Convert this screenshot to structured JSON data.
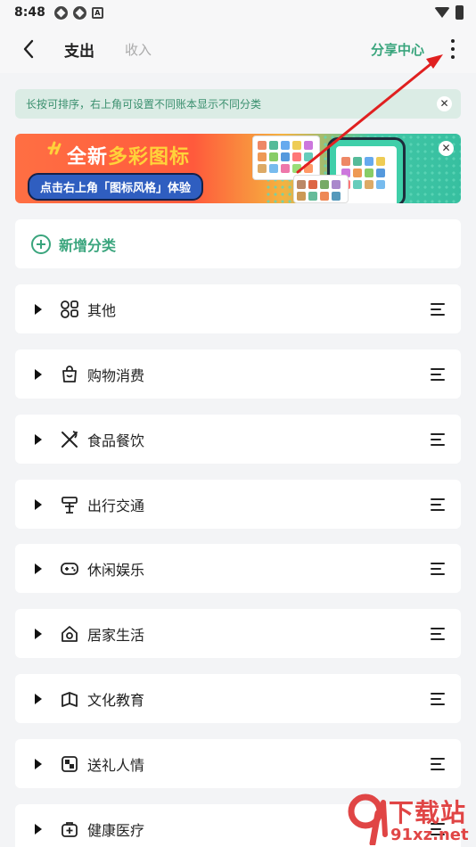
{
  "status_bar": {
    "time": "8:48"
  },
  "nav": {
    "tab_expense": "支出",
    "tab_income": "收入",
    "share_center": "分享中心"
  },
  "tip": {
    "text": "长按可排序，右上角可设置不同账本显示不同分类"
  },
  "banner": {
    "title_prefix": "全新",
    "title_highlight": "多彩图标",
    "subtitle": "点击右上角「图标风格」体验"
  },
  "add_category": {
    "label": "新增分类"
  },
  "categories": [
    {
      "label": "其他",
      "icon": "grid-shapes-icon"
    },
    {
      "label": "购物消费",
      "icon": "shopping-bag-icon"
    },
    {
      "label": "食品餐饮",
      "icon": "fork-knife-icon"
    },
    {
      "label": "出行交通",
      "icon": "signpost-icon"
    },
    {
      "label": "休闲娱乐",
      "icon": "gamepad-icon"
    },
    {
      "label": "居家生活",
      "icon": "home-icon"
    },
    {
      "label": "文化教育",
      "icon": "book-icon"
    },
    {
      "label": "送礼人情",
      "icon": "gift-icon"
    },
    {
      "label": "健康医疗",
      "icon": "medical-kit-icon"
    }
  ],
  "watermark": {
    "brand": "下载站",
    "domain": "91xz.net"
  },
  "colors": {
    "accent": "#3aa57d",
    "tip_bg": "#dbece5",
    "annotation": "#e02020"
  }
}
